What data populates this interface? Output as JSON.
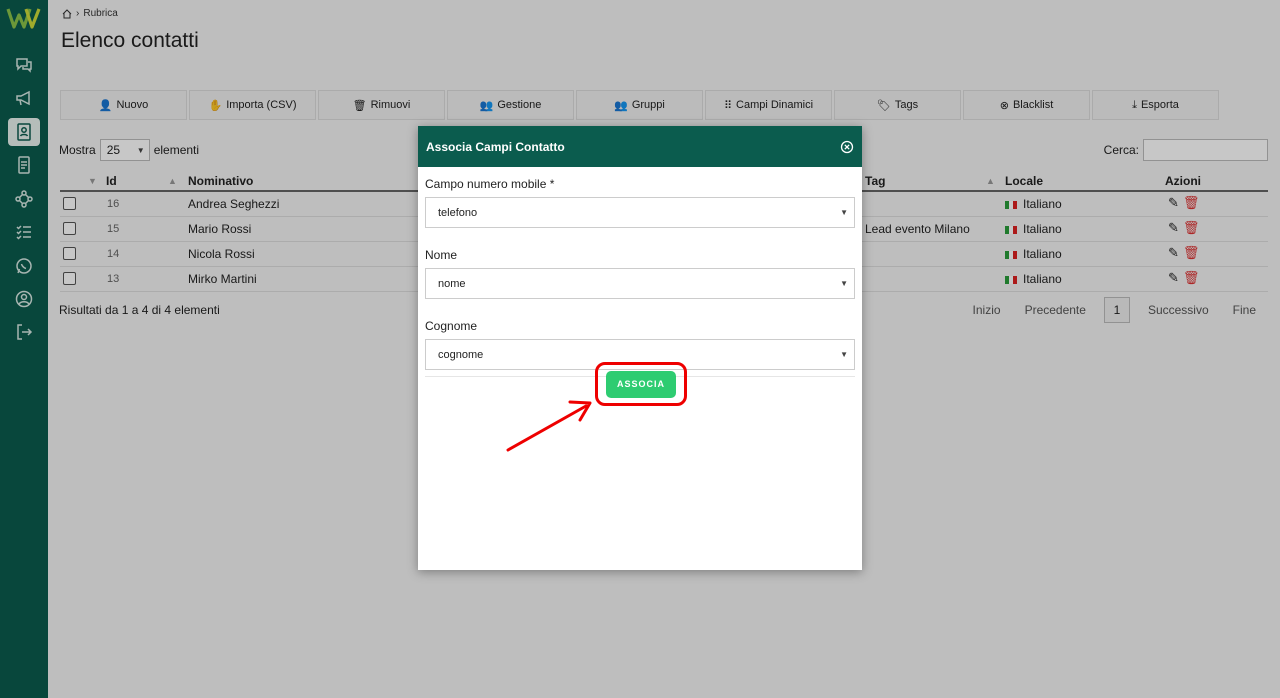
{
  "breadcrumb": {
    "current": "Rubrica"
  },
  "page": {
    "title": "Elenco contatti"
  },
  "toolbar": [
    {
      "label": "Nuovo",
      "icon": "user-plus-icon",
      "glyph": "👤"
    },
    {
      "label": "Importa (CSV)",
      "icon": "hand-icon",
      "glyph": "✋"
    },
    {
      "label": "Rimuovi",
      "icon": "trash-icon",
      "glyph": "🗑"
    },
    {
      "label": "Gestione",
      "icon": "users-icon",
      "glyph": "👥"
    },
    {
      "label": "Gruppi",
      "icon": "group-icon",
      "glyph": "👥"
    },
    {
      "label": "Campi Dinamici",
      "icon": "grid-icon",
      "glyph": "⠿"
    },
    {
      "label": "Tags",
      "icon": "tag-icon",
      "glyph": "🏷"
    },
    {
      "label": "Blacklist",
      "icon": "block-icon",
      "glyph": "⊗"
    },
    {
      "label": "Esporta",
      "icon": "download-icon",
      "glyph": "⤓"
    }
  ],
  "length_menu": {
    "prefix": "Mostra",
    "value": "25",
    "suffix": "elementi"
  },
  "search": {
    "label": "Cerca:"
  },
  "table": {
    "headers": {
      "id": "Id",
      "name": "Nominativo",
      "tag": "Tag",
      "locale": "Locale",
      "actions": "Azioni"
    },
    "rows": [
      {
        "id": "16",
        "name": "Andrea Seghezzi",
        "tag": "",
        "locale": "Italiano"
      },
      {
        "id": "15",
        "name": "Mario Rossi",
        "tag": "Lead evento Milano",
        "locale": "Italiano"
      },
      {
        "id": "14",
        "name": "Nicola Rossi",
        "tag": "",
        "locale": "Italiano"
      },
      {
        "id": "13",
        "name": "Mirko Martini",
        "tag": "",
        "locale": "Italiano"
      }
    ]
  },
  "results": "Risultati da 1 a 4 di 4 elementi",
  "pager": {
    "first": "Inizio",
    "prev": "Precedente",
    "current": "1",
    "next": "Successivo",
    "last": "Fine"
  },
  "modal": {
    "title": "Associa Campi Contatto",
    "fields": [
      {
        "label": "Campo numero mobile *",
        "value": "telefono"
      },
      {
        "label": "Nome",
        "value": "nome"
      },
      {
        "label": "Cognome",
        "value": "cognome"
      }
    ],
    "submit": "ASSOCIA"
  },
  "colors": {
    "brand": "#0b5c4e",
    "submit": "#2ecc71",
    "highlight": "#e00000"
  }
}
